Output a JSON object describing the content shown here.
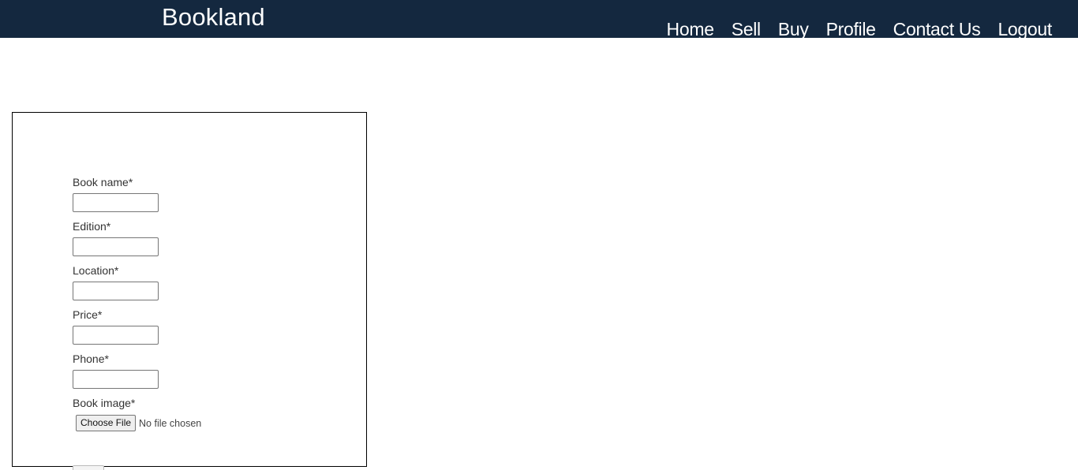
{
  "header": {
    "brand": "Bookland",
    "nav": [
      "Home",
      "Sell",
      "Buy",
      "Profile",
      "Contact Us",
      "Logout"
    ]
  },
  "form": {
    "fields": [
      {
        "label": "Book name*",
        "value": ""
      },
      {
        "label": "Edition*",
        "value": ""
      },
      {
        "label": "Location*",
        "value": ""
      },
      {
        "label": "Price*",
        "value": ""
      },
      {
        "label": "Phone*",
        "value": ""
      }
    ],
    "image_label": "Book image*",
    "file_button": "Choose File",
    "file_status": "No file chosen"
  },
  "colors": {
    "navbar_bg": "#14283f",
    "nav_text": "#ffffff",
    "card_border": "#000000"
  }
}
